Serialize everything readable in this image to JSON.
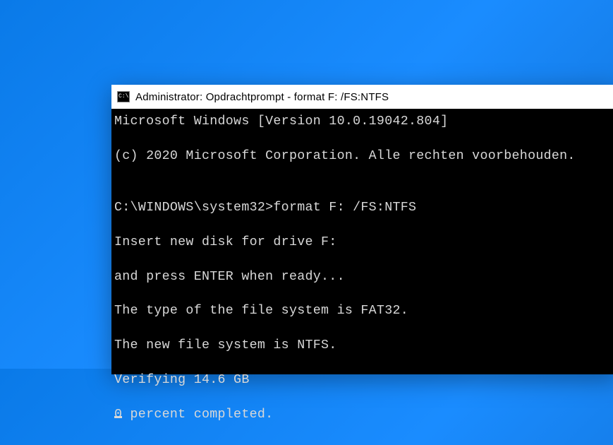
{
  "window": {
    "title": "Administrator: Opdrachtprompt - format  F: /FS:NTFS"
  },
  "terminal": {
    "lines": [
      "Microsoft Windows [Version 10.0.19042.804]",
      "(c) 2020 Microsoft Corporation. Alle rechten voorbehouden.",
      "",
      "C:\\WINDOWS\\system32>format F: /FS:NTFS",
      "Insert new disk for drive F:",
      "and press ENTER when ready...",
      "The type of the file system is FAT32.",
      "The new file system is NTFS.",
      "Verifying 14.6 GB",
      "0 percent completed."
    ],
    "cursor_line_index": 9
  }
}
